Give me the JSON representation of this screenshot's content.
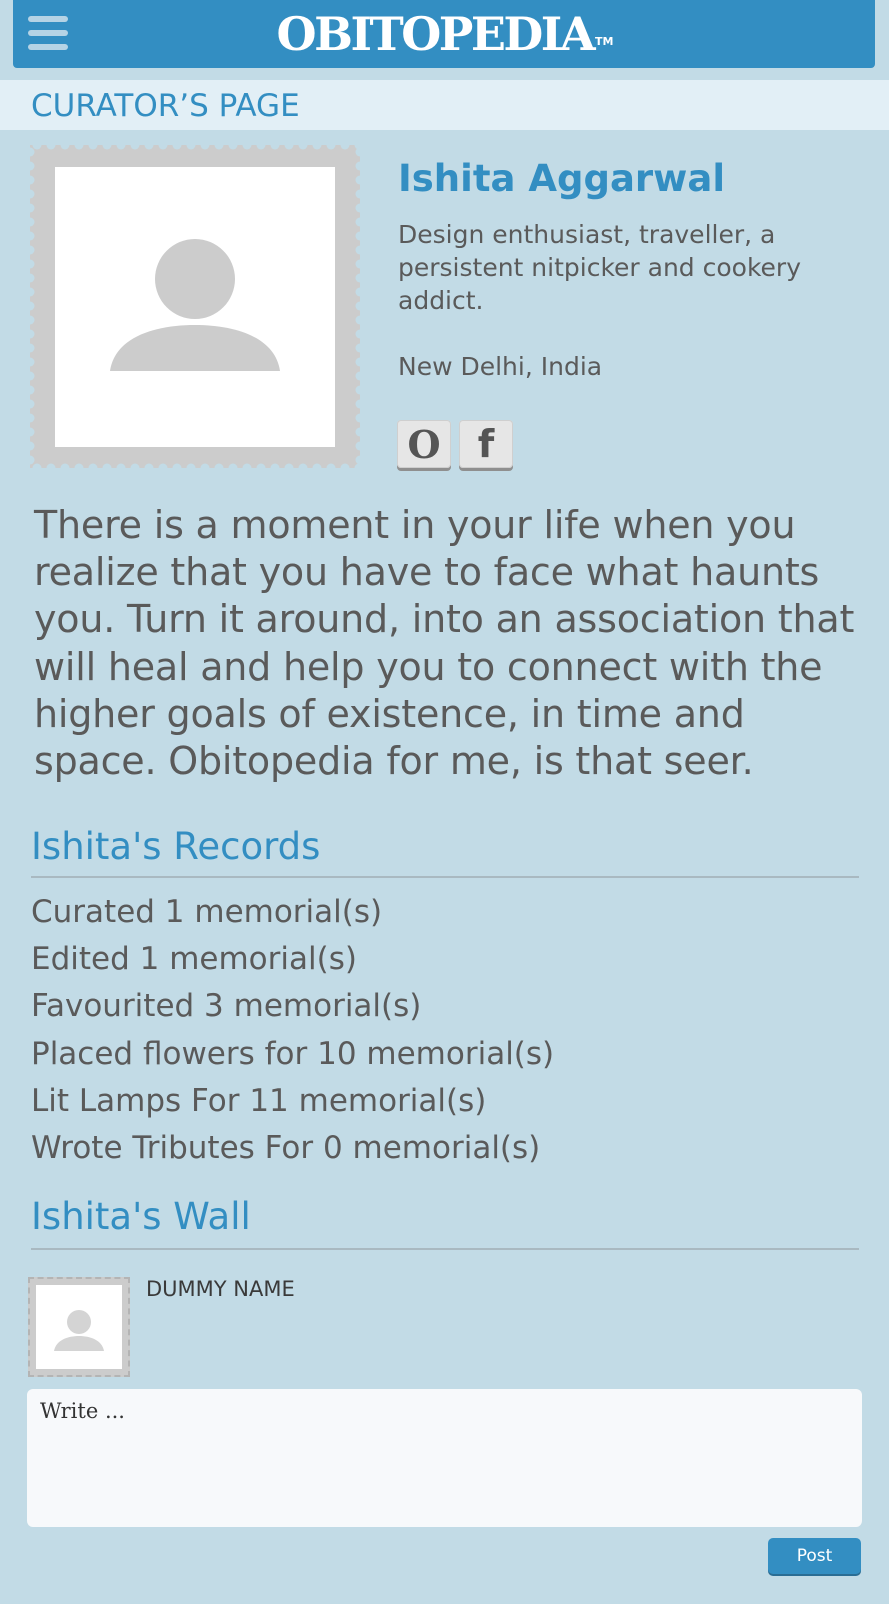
{
  "header": {
    "logo": "OBITOPEDIA",
    "trademark": "TM"
  },
  "page_title": "CURATOR’S PAGE",
  "profile": {
    "name": "Ishita Aggarwal",
    "bio": "Design enthusiast, traveller, a persistent nitpicker and cookery addict.",
    "location": "New Delhi, India",
    "social": {
      "obitopedia": "O",
      "facebook": "f"
    }
  },
  "quote": "There is a moment in your life when you realize that you have to face what haunts you. Turn it around, into an association that will heal and help you to connect with the higher goals of existence, in time and space. Obitopedia for me, is that seer.",
  "records": {
    "title": "Ishita's Records",
    "items": [
      "Curated 1 memorial(s)",
      "Edited 1 memorial(s)",
      "Favourited 3 memorial(s)",
      "Placed flowers for 10 memorial(s)",
      "Lit Lamps For 11 memorial(s)",
      "Wrote Tributes For 0 memorial(s)"
    ]
  },
  "wall": {
    "title": "Ishita's Wall",
    "user_name": "DUMMY NAME",
    "placeholder": "Write ...",
    "post_label": "Post"
  },
  "colors": {
    "accent": "#338ec2",
    "background": "#c2dbe6",
    "text": "#5a5a5a"
  }
}
